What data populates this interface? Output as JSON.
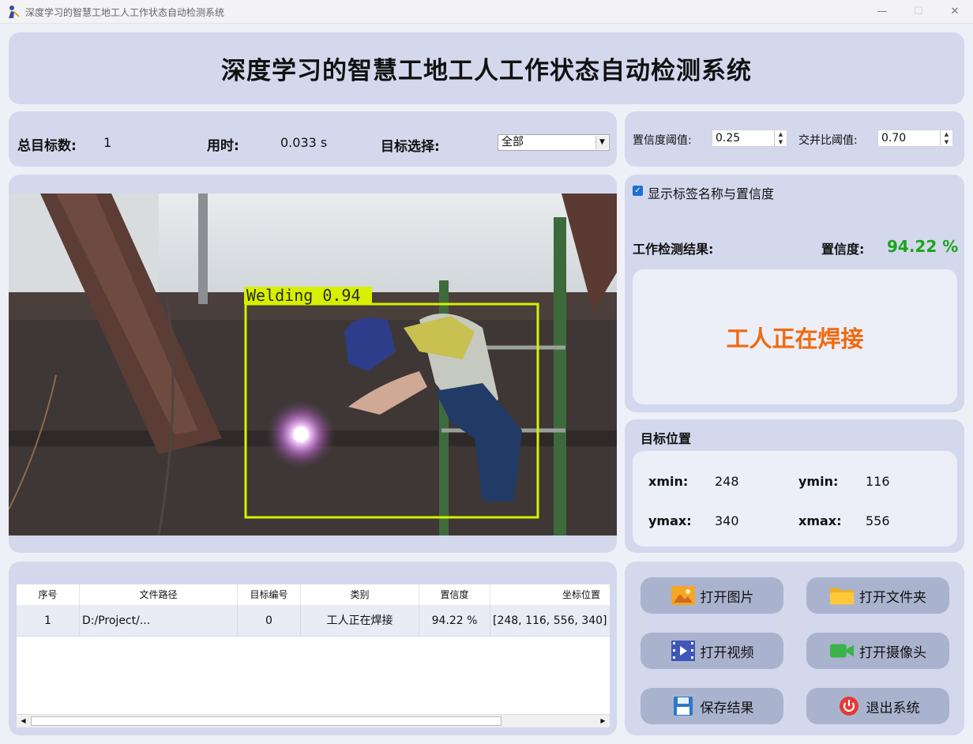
{
  "window": {
    "title": "深度学习的智慧工地工人工作状态自动检测系统",
    "icon": "worker-icon",
    "controls": [
      "minimize-icon",
      "maximize-icon",
      "close-icon"
    ]
  },
  "header": {
    "title": "深度学习的智慧工地工人工作状态自动检测系统"
  },
  "stats": {
    "total_label": "总目标数:",
    "total_value": "1",
    "time_label": "用时:",
    "time_value": "0.033 s",
    "target_label": "目标选择:",
    "target_selected": "全部"
  },
  "params": {
    "conf_label": "置信度阈值:",
    "conf_value": "0.25",
    "iou_label": "交并比阈值:",
    "iou_value": "0.70"
  },
  "detection": {
    "box_label": "Welding 0.94",
    "box_color": "#d7f000"
  },
  "side": {
    "show_label_text": "显示标签名称与置信度",
    "show_label_checked": true,
    "result_label": "工作检测结果:",
    "conf_label": "置信度:",
    "conf_value": "94.22 %",
    "conf_color": "#1aa51a",
    "result_text": "工人正在焊接",
    "result_color": "#f06a10"
  },
  "position": {
    "title": "目标位置",
    "xmin_label": "xmin:",
    "xmin_value": "248",
    "ymin_label": "ymin:",
    "ymin_value": "116",
    "ymax_label": "ymax:",
    "ymax_value": "340",
    "xmax_label": "xmax:",
    "xmax_value": "556"
  },
  "table": {
    "headers": [
      "序号",
      "文件路径",
      "目标编号",
      "类别",
      "置信度",
      "坐标位置"
    ],
    "rows": [
      [
        "1",
        "D:/Project/...",
        "0",
        "工人正在焊接",
        "94.22 %",
        "[248, 116, 556, 340]"
      ]
    ]
  },
  "buttons": {
    "open_image": "打开图片",
    "open_folder": "打开文件夹",
    "open_video": "打开视频",
    "open_camera": "打开摄像头",
    "save": "保存结果",
    "exit": "退出系统"
  }
}
